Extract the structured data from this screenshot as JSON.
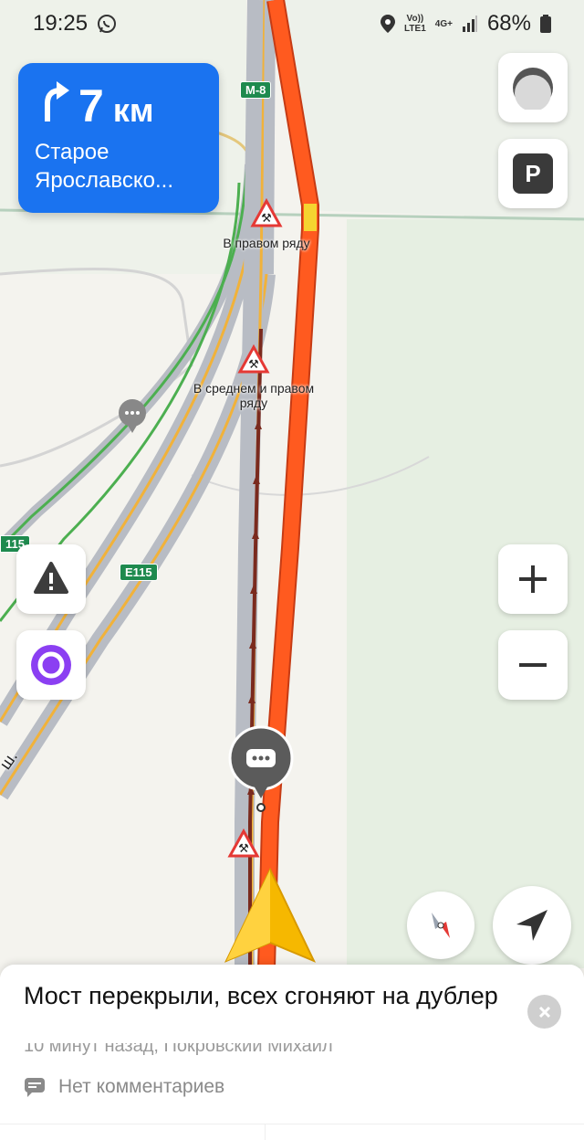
{
  "status_bar": {
    "time": "19:25",
    "network_top": "Vo))",
    "network_bottom": "LTE1",
    "generation": "4G+",
    "battery": "68%"
  },
  "maneuver": {
    "distance": "7",
    "unit": "км",
    "street_line1": "Старое",
    "street_line2": "Ярославско..."
  },
  "map": {
    "road_shield_m8": "М-8",
    "road_shield_e115_left": "115",
    "road_shield_e115": "E115",
    "label_right_lane": "В правом ряду",
    "label_middle_right_line1": "В среднем и правом",
    "label_middle_right_line2": "ряду",
    "road_text_fragment": "ш."
  },
  "buttons": {
    "parking_label": "P"
  },
  "message": {
    "title": "Мост перекрыли, всех сгоняют на дублер",
    "meta": "10 минут назад, Покровский Михаил",
    "comments": "Нет комментариев"
  },
  "colors": {
    "route": "#ff5a1f",
    "route_yellow": "#f5d430",
    "maneuver_bg": "#1a73f0",
    "traffic_green": "#4caf50",
    "road_gray": "#b8bcc4",
    "lane_dark": "#7a2a1e"
  }
}
